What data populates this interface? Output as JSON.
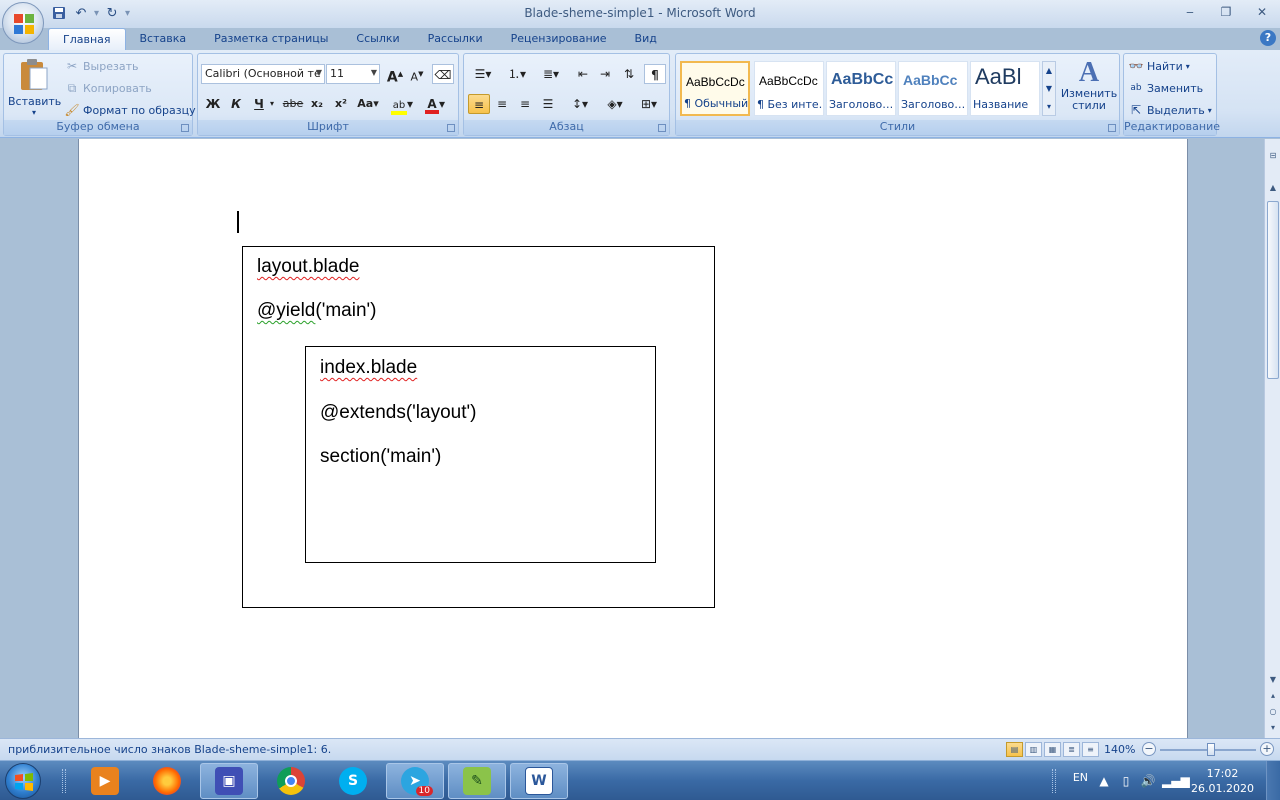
{
  "window": {
    "title": "Blade-sheme-simple1 - Microsoft Word",
    "minimize": "‒",
    "maximize": "❐",
    "close": "✕"
  },
  "qat": {
    "save_icon": "save-icon",
    "undo_icon": "undo-icon",
    "redo_icon": "redo-icon",
    "customize_icon": "customize-icon"
  },
  "tabs": [
    "Главная",
    "Вставка",
    "Разметка страницы",
    "Ссылки",
    "Рассылки",
    "Рецензирование",
    "Вид"
  ],
  "help_label": "?",
  "ribbon": {
    "clipboard": {
      "label": "Буфер обмена",
      "paste": "Вставить",
      "cut": "Вырезать",
      "copy": "Копировать",
      "format_painter": "Формат по образцу"
    },
    "font": {
      "label": "Шрифт",
      "font_name": "Calibri (Основной те",
      "font_size": "11",
      "bold": "Ж",
      "italic": "К",
      "underline": "Ч",
      "strike": "abe",
      "subscript": "x₂",
      "superscript": "x²",
      "change_case": "Aa",
      "grow": "A",
      "shrink": "A"
    },
    "paragraph": {
      "label": "Абзац",
      "show_marks": "¶"
    },
    "styles": {
      "label": "Стили",
      "items": [
        {
          "sample": "AaBbCcDc",
          "name": "¶ Обычный",
          "selected": true
        },
        {
          "sample": "AaBbCcDc",
          "name": "¶ Без инте…",
          "selected": false
        },
        {
          "sample": "AaBbCc",
          "name": "Заголово…",
          "selected": false
        },
        {
          "sample": "AaBbCc",
          "name": "Заголово…",
          "selected": false
        },
        {
          "sample": "AaBl",
          "name": "Название",
          "selected": false
        }
      ],
      "change_styles": "Изменить стили"
    },
    "editing": {
      "label": "Редактирование",
      "find": "Найти",
      "replace": "Заменить",
      "select": "Выделить"
    }
  },
  "document": {
    "outer_box": {
      "title": "layout.blade",
      "directive": "@yield",
      "arg": "('main')"
    },
    "inner_box": {
      "title": "index.blade",
      "directive1": "@extends",
      "arg1": "('layout')",
      "directive2": "section",
      "arg2": "('main')"
    }
  },
  "status": {
    "text": "приблизительное число знаков Blade-sheme-simple1: 6.",
    "zoom": "140%"
  },
  "taskbar": {
    "lang": "EN",
    "time": "17:02",
    "date": "26.01.2020",
    "telegram_badge": "10",
    "apps": [
      "video-player-icon",
      "firefox-icon",
      "save-app-icon",
      "chrome-icon",
      "skype-icon",
      "telegram-icon",
      "notepad-plus-icon",
      "word-icon"
    ]
  },
  "colors": {
    "ribbon_bg": "#dbe7f6",
    "accent_blue": "#15428b",
    "selected_style": "#f2b94f",
    "taskbar": "#3a6aa5"
  }
}
